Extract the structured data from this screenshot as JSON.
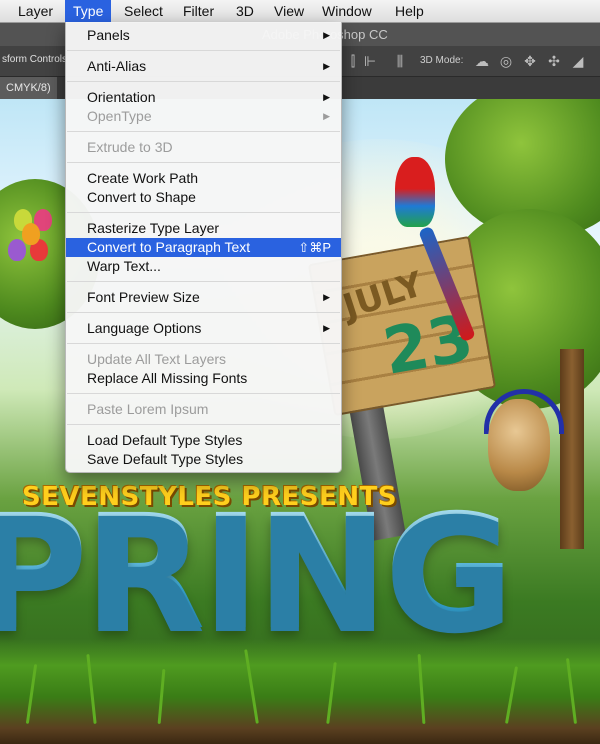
{
  "menubar": {
    "items": [
      "Layer",
      "Type",
      "Select",
      "Filter",
      "3D",
      "View",
      "Window",
      "Help"
    ],
    "active": "Type"
  },
  "app": {
    "title": "Adobe Photoshop CC",
    "options_label": "sform Controls",
    "mode_label": "3D Mode:",
    "doc_tab": "CMYK/8)"
  },
  "type_menu": {
    "panels": "Panels",
    "anti_alias": "Anti-Alias",
    "orientation": "Orientation",
    "opentype": "OpenType",
    "extrude_3d": "Extrude to 3D",
    "create_work_path": "Create Work Path",
    "convert_to_shape": "Convert to Shape",
    "rasterize": "Rasterize Type Layer",
    "convert_paragraph": "Convert to Paragraph Text",
    "convert_paragraph_shortcut": "⇧⌘P",
    "warp_text": "Warp Text...",
    "font_preview_size": "Font Preview Size",
    "language_options": "Language Options",
    "update_all": "Update All Text Layers",
    "replace_fonts": "Replace All Missing Fonts",
    "paste_lorem": "Paste Lorem Ipsum",
    "load_styles": "Load Default Type Styles",
    "save_styles": "Save Default Type Styles"
  },
  "artwork": {
    "sign_top": "JULY",
    "sign_number": "23",
    "presents": "SEVENSTYLES PRESENTS",
    "big_word": "PRING"
  },
  "colors": {
    "menu_highlight": "#2a62e0",
    "disabled_text": "#9c9c9c",
    "presents_yellow": "#ffcf1d",
    "spring_blue": "#4fb6d9"
  }
}
